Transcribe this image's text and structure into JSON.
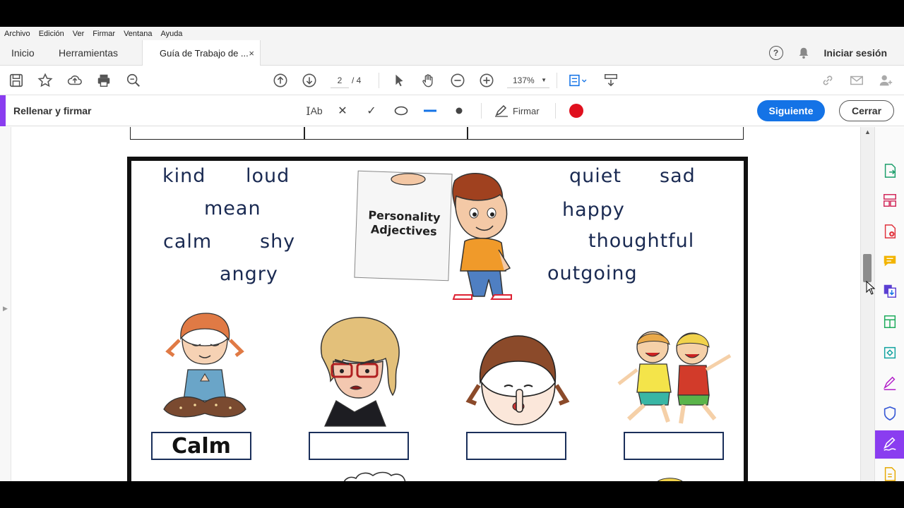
{
  "menubar": {
    "items": [
      "Archivo",
      "Edición",
      "Ver",
      "Firmar",
      "Ventana",
      "Ayuda"
    ]
  },
  "tabs": {
    "inicio": "Inicio",
    "herramientas": "Herramientas",
    "document": "Guía de Trabajo de ...",
    "close": "×"
  },
  "header": {
    "signin": "Iniciar sesión"
  },
  "toolbar": {
    "current_page": "2",
    "total_pages": "/ 4",
    "zoom": "137%"
  },
  "fillsign": {
    "title": "Rellenar y firmar",
    "text_tool": "Ab",
    "cross": "✕",
    "check": "✓",
    "sign_label": "Firmar",
    "next_button": "Siguiente",
    "close_button": "Cerrar",
    "ink_color": "#e0101e"
  },
  "worksheet": {
    "words": [
      "kind",
      "loud",
      "quiet",
      "sad",
      "mean",
      "happy",
      "calm",
      "shy",
      "thoughtful",
      "angry",
      "outgoing"
    ],
    "sign_text_line1": "Personality",
    "sign_text_line2": "Adjectives",
    "answers": [
      "Calm",
      "",
      "",
      ""
    ]
  },
  "colors": {
    "accent_purple": "#8a3df0",
    "primary_blue": "#1473e6",
    "word_navy": "#1a2a52"
  }
}
